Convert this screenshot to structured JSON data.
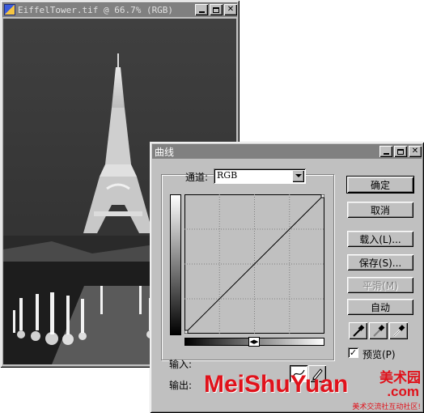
{
  "image_window": {
    "title": "EiffelTower.tif @ 66.7% (RGB)",
    "controls": [
      "minimize",
      "maximize",
      "close"
    ]
  },
  "curves_dialog": {
    "title": "曲线",
    "channel_label": "通道:",
    "channel_value": "RGB",
    "input_label": "输入:",
    "output_label": "输出:",
    "buttons": {
      "ok": "确定",
      "cancel": "取消",
      "load": "载入(L)...",
      "save": "保存(S)...",
      "smooth": "平滑(M)",
      "auto": "自动"
    },
    "preview_label": "预览(P)",
    "preview_checked": true,
    "curve": {
      "points": [
        [
          0,
          0
        ],
        [
          255,
          255
        ]
      ]
    },
    "eyedroppers": [
      "black-point",
      "gray-point",
      "white-point"
    ],
    "tools": [
      "curve-tool",
      "pencil-tool"
    ],
    "active_tool": "curve-tool"
  },
  "watermark": {
    "brand": "MeiShuYuan",
    "domain_suffix": ".com",
    "chinese": "美术园",
    "slogan": "美术交流社互动社区!",
    "color": "#e0121b"
  }
}
